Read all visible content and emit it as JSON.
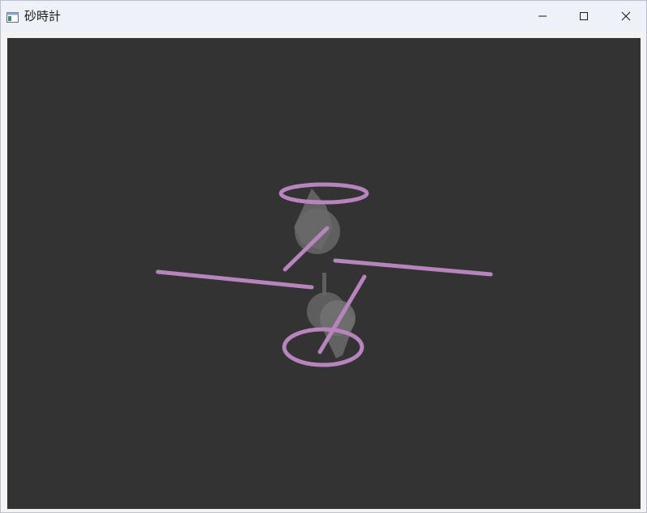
{
  "window": {
    "title": "砂時計",
    "controls": {
      "minimize_icon": "minimize-icon",
      "maximize_icon": "maximize-icon",
      "close_icon": "close-icon"
    }
  },
  "colors": {
    "titlebar": "#eef1f8",
    "client_background": "#333333",
    "accent_stroke": "#b784bd",
    "shape_fill": "#6a6a6a"
  }
}
